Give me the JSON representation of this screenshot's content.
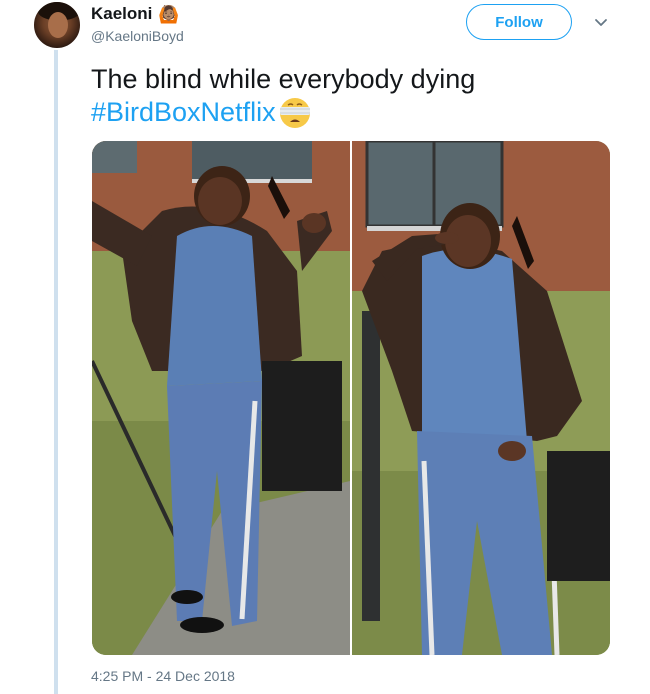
{
  "user": {
    "display_name": "Kaeloni",
    "name_emoji": "🙆🏽",
    "handle": "@KaeloniBoyd"
  },
  "actions": {
    "follow_label": "Follow",
    "menu_icon": "chevron-down-icon"
  },
  "tweet": {
    "text_line": "The blind while everybody dying",
    "hashtag": "#BirdBoxNetflix",
    "hashtag_emoji": "blindfolded-face-emoji"
  },
  "media": {
    "photo_count": 2
  },
  "timestamp": "4:25 PM - 24 Dec 2018",
  "colors": {
    "link": "#1da1f2",
    "text": "#14171a",
    "secondary": "#657786",
    "thread_line": "#cfe0ee"
  }
}
